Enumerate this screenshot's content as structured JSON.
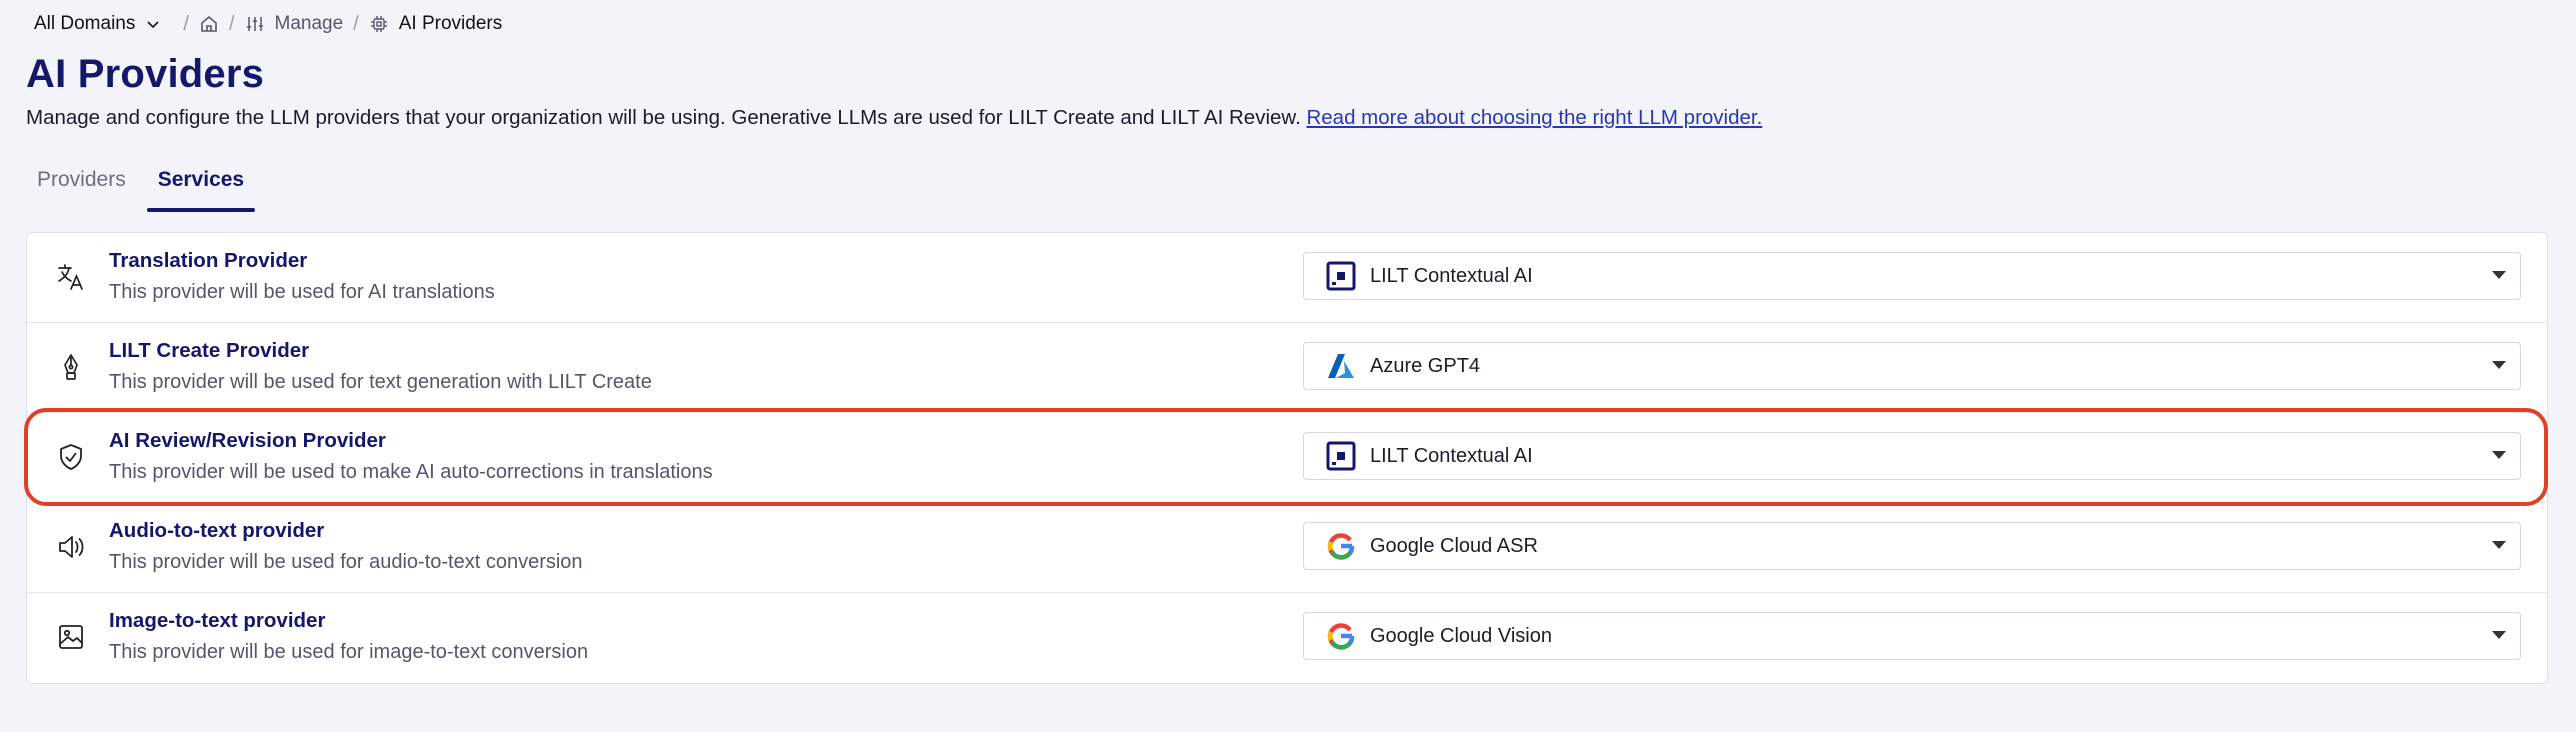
{
  "breadcrumb": {
    "domain": "All Domains",
    "manage": "Manage",
    "current": "AI Providers"
  },
  "page": {
    "title": "AI Providers",
    "description": "Manage and configure the LLM providers that your organization will be using. Generative LLMs are used for LILT Create and LILT AI Review. ",
    "link": "Read more about choosing the right LLM provider."
  },
  "tabs": [
    {
      "label": "Providers",
      "active": false
    },
    {
      "label": "Services",
      "active": true
    }
  ],
  "services": [
    {
      "icon": "translate-icon",
      "title": "Translation Provider",
      "subtitle": "This provider will be used for AI translations",
      "provider": "LILT Contextual AI",
      "provider_logo": "lilt-logo"
    },
    {
      "icon": "pen-nib-icon",
      "title": "LILT Create Provider",
      "subtitle": "This provider will be used for text generation with LILT Create",
      "provider": "Azure GPT4",
      "provider_logo": "azure-logo"
    },
    {
      "icon": "shield-check-icon",
      "title": "AI Review/Revision Provider",
      "subtitle": "This provider will be used to make AI auto-corrections in translations",
      "provider": "LILT Contextual AI",
      "provider_logo": "lilt-logo"
    },
    {
      "icon": "speaker-icon",
      "title": "Audio-to-text provider",
      "subtitle": "This provider will be used for audio-to-text conversion",
      "provider": "Google Cloud ASR",
      "provider_logo": "google-logo"
    },
    {
      "icon": "image-icon",
      "title": "Image-to-text provider",
      "subtitle": "This provider will be used for image-to-text conversion",
      "provider": "Google Cloud Vision",
      "provider_logo": "google-logo"
    }
  ],
  "colors": {
    "title": "#15176a",
    "highlight": "#e0402a",
    "link": "#2a36b8"
  }
}
